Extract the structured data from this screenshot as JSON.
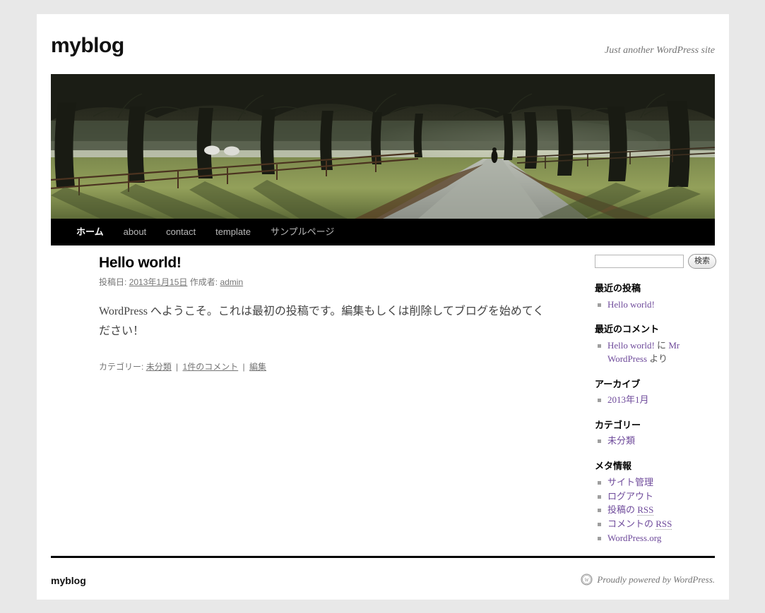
{
  "site": {
    "title": "myblog",
    "description": "Just another WordPress site"
  },
  "nav": {
    "items": [
      {
        "label": "ホーム",
        "current": true
      },
      {
        "label": "about",
        "current": false
      },
      {
        "label": "contact",
        "current": false
      },
      {
        "label": "template",
        "current": false
      },
      {
        "label": "サンプルページ",
        "current": false
      }
    ]
  },
  "header_image": {
    "alt": "tree-lined gravel path with wooden fence and field"
  },
  "post": {
    "title": "Hello world!",
    "meta_posted_label": "投稿日:",
    "meta_date": "2013年1月15日",
    "meta_author_label": "作成者:",
    "meta_author": "admin",
    "content": "WordPress へようこそ。これは最初の投稿です。編集もしくは削除してブログを始めてください！",
    "footer_category_label": "カテゴリー:",
    "footer_category": "未分類",
    "footer_comments": "1件のコメント",
    "footer_edit": "編集",
    "separator": "|"
  },
  "search": {
    "value": "",
    "placeholder": "",
    "button_label": "検索"
  },
  "widgets": [
    {
      "title": "最近の投稿",
      "items": [
        {
          "link": "Hello world!"
        }
      ]
    },
    {
      "title": "最近のコメント",
      "items": [
        {
          "link": "Hello world!",
          "mid": " に ",
          "link2": "Mr WordPress",
          "tail": " より"
        }
      ]
    },
    {
      "title": "アーカイブ",
      "items": [
        {
          "link": "2013年1月"
        }
      ]
    },
    {
      "title": "カテゴリー",
      "items": [
        {
          "link": "未分類"
        }
      ]
    },
    {
      "title": "メタ情報",
      "items": [
        {
          "link": "サイト管理"
        },
        {
          "link": "ログアウト"
        },
        {
          "link": "投稿の ",
          "abbr": "RSS"
        },
        {
          "link": "コメントの ",
          "abbr": "RSS"
        },
        {
          "link": "WordPress.org"
        }
      ]
    }
  ],
  "footer": {
    "site_title": "myblog",
    "credit": "Proudly powered by WordPress.",
    "logo": "wordpress-logo"
  },
  "colors": {
    "page_bg": "#e8e8e8",
    "container_bg": "#ffffff",
    "nav_bg": "#000000",
    "link": "#6f4b9b",
    "muted": "#757575"
  }
}
